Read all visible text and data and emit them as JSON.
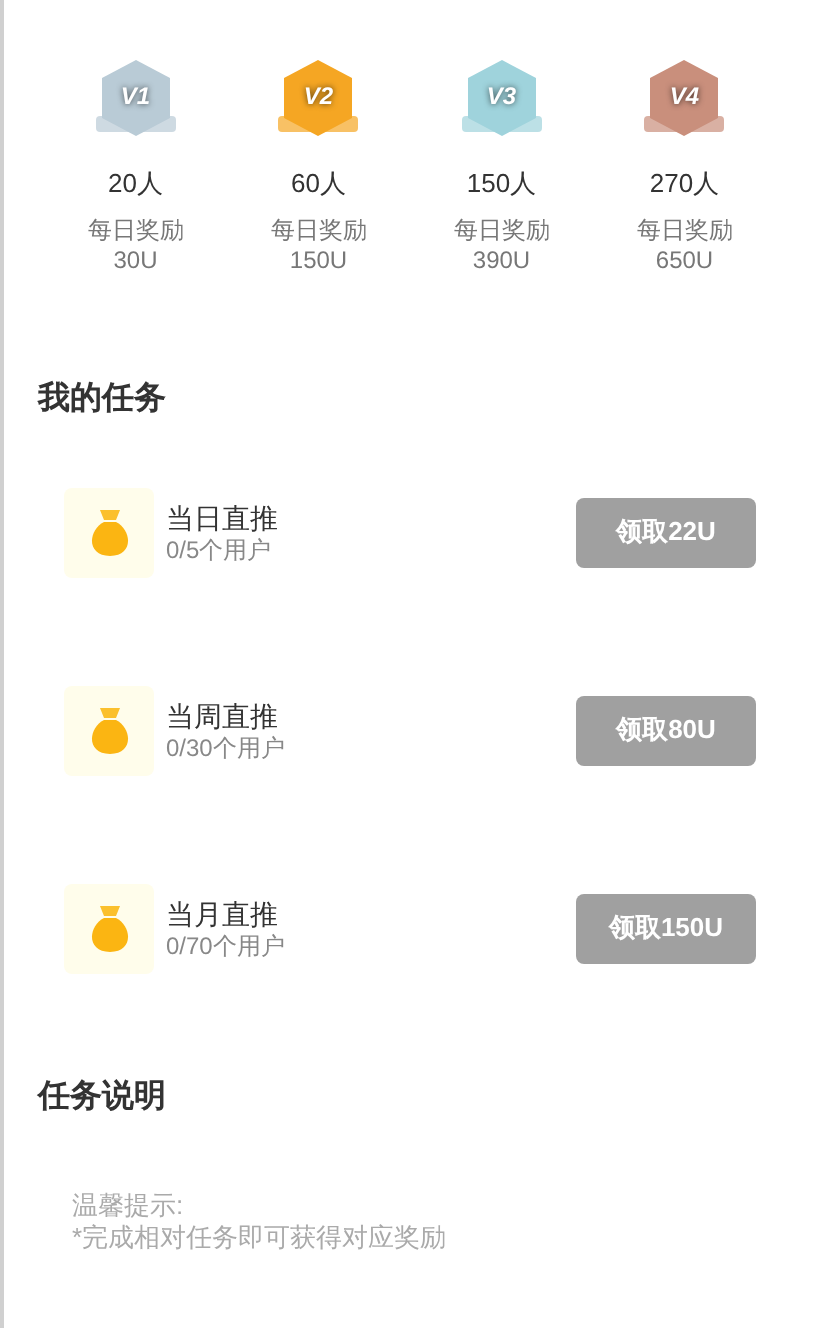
{
  "levels": [
    {
      "badge_text": "V1",
      "color": "#b9cbd6",
      "people": "20人",
      "reward_label": "每日奖励",
      "reward": "30U"
    },
    {
      "badge_text": "V2",
      "color": "#f5a623",
      "people": "60人",
      "reward_label": "每日奖励",
      "reward": "150U"
    },
    {
      "badge_text": "V3",
      "color": "#9fd3dc",
      "people": "150人",
      "reward_label": "每日奖励",
      "reward": "390U"
    },
    {
      "badge_text": "V4",
      "color": "#c98f7c",
      "people": "270人",
      "reward_label": "每日奖励",
      "reward": "650U"
    }
  ],
  "my_tasks": {
    "title": "我的任务",
    "tasks": [
      {
        "name": "当日直推",
        "progress": "0/5个用户",
        "button": "领取22U",
        "disabled": true
      },
      {
        "name": "当周直推",
        "progress": "0/30个用户",
        "button": "领取80U",
        "disabled": true
      },
      {
        "name": "当月直推",
        "progress": "0/70个用户",
        "button": "领取150U",
        "disabled": true
      }
    ]
  },
  "task_notes": {
    "title": "任务说明",
    "lines": [
      "温馨提示:",
      "*完成相对任务即可获得对应奖励"
    ]
  }
}
